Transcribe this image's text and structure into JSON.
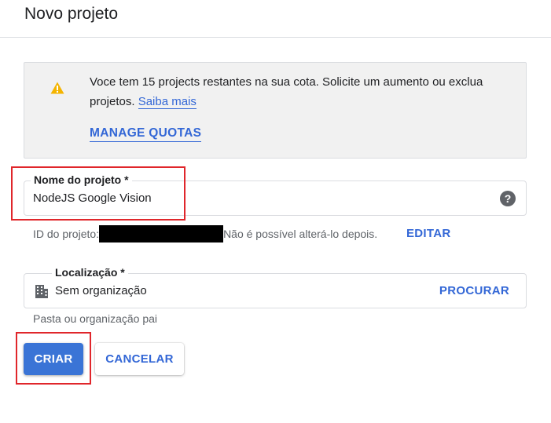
{
  "dialog": {
    "title": "Novo projeto"
  },
  "notice": {
    "icon": "warning-icon",
    "text_before_link": "Voce tem 15 projects restantes na sua cota. Solicite um aumento ou exclua projetos. ",
    "link_label": "Saiba mais",
    "manage_label": "MANAGE QUOTAS"
  },
  "project_name": {
    "label": "Nome do projeto *",
    "value": "NodeJS Google Vision",
    "help_icon": "help-icon",
    "help_glyph": "?"
  },
  "project_id": {
    "prefix": "ID do projeto:",
    "note": "Não é possível alterá-lo depois.",
    "edit_label": "EDITAR"
  },
  "location": {
    "label": "Localização *",
    "value": "Sem organização",
    "icon": "building-icon",
    "browse_label": "PROCURAR",
    "hint": "Pasta ou organização pai"
  },
  "actions": {
    "create_label": "CRIAR",
    "cancel_label": "CANCELAR"
  },
  "colors": {
    "accent": "#3367d6",
    "primary_button": "#3a74d6",
    "highlight_box": "#e0262b",
    "warning": "#f4b400"
  }
}
